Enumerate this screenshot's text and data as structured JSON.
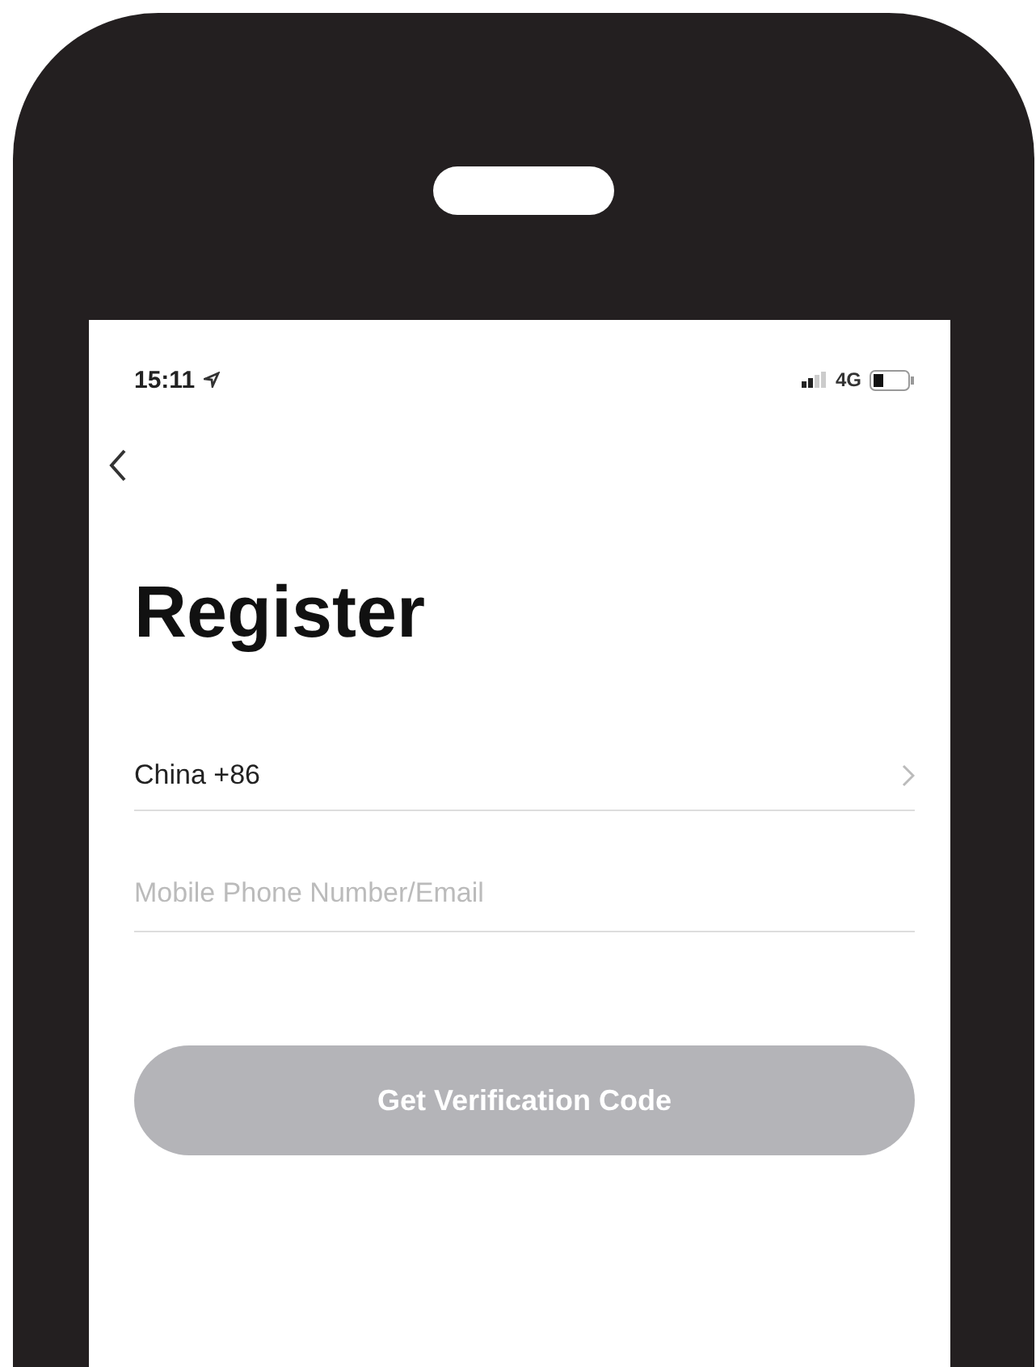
{
  "status_bar": {
    "time": "15:11",
    "network": "4G"
  },
  "title": "Register",
  "country_row": {
    "value": "China +86"
  },
  "contact_field": {
    "placeholder": "Mobile Phone Number/Email"
  },
  "submit_button": {
    "label": "Get Verification Code",
    "disabled": true
  }
}
